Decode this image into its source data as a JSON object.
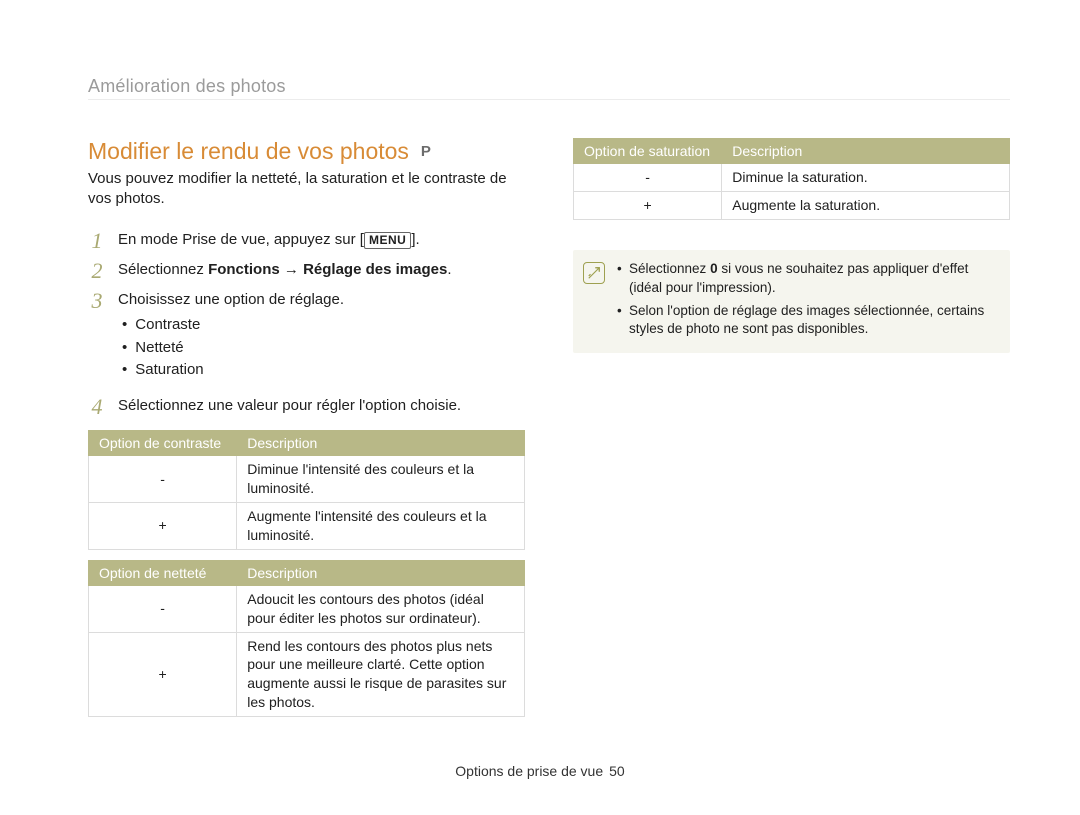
{
  "header": {
    "running": "Amélioration des photos"
  },
  "title": "Modifier le rendu de vos photos",
  "mode_badge": "P",
  "intro": "Vous pouvez modifier la netteté, la saturation et le contraste de vos photos.",
  "steps": {
    "s1_prefix": "En mode Prise de vue, appuyez sur [",
    "s1_suffix": "].",
    "menu_key": "MENU",
    "s2_prefix": "Sélectionnez ",
    "s2_bold_a": "Fonctions",
    "s2_arrow": "→",
    "s2_bold_b": "Réglage des images",
    "s2_suffix": ".",
    "s3": "Choisissez une option de réglage.",
    "s4": "Sélectionnez une valeur pour régler l'option choisie.",
    "nums": {
      "1": "1",
      "2": "2",
      "3": "3",
      "4": "4"
    }
  },
  "bullets": [
    "Contraste",
    "Netteté",
    "Saturation"
  ],
  "tables": {
    "contrast": {
      "head": [
        "Option de contraste",
        "Description"
      ],
      "rows": [
        {
          "key": "-",
          "desc": "Diminue l'intensité des couleurs et la luminosité."
        },
        {
          "key": "+",
          "desc": "Augmente l'intensité des couleurs et la luminosité."
        }
      ]
    },
    "sharp": {
      "head": [
        "Option de netteté",
        "Description"
      ],
      "rows": [
        {
          "key": "-",
          "desc": "Adoucit les contours des photos (idéal pour éditer les photos sur ordinateur)."
        },
        {
          "key": "+",
          "desc": "Rend les contours des photos plus nets pour une meilleure clarté. Cette option augmente aussi le risque de parasites sur les photos."
        }
      ]
    },
    "sat": {
      "head": [
        "Option de saturation",
        "Description"
      ],
      "rows": [
        {
          "key": "-",
          "desc": "Diminue la saturation."
        },
        {
          "key": "+",
          "desc": "Augmente la saturation."
        }
      ]
    }
  },
  "note": {
    "items": [
      {
        "pre": "Sélectionnez ",
        "bold": "0",
        "post": " si vous ne souhaitez pas appliquer d'effet (idéal pour l'impression)."
      },
      {
        "pre": "",
        "bold": "",
        "post": "Selon l'option de réglage des images sélectionnée, certains styles de photo ne sont pas disponibles."
      }
    ]
  },
  "footer": {
    "label": "Options de prise de vue",
    "page": "50"
  }
}
